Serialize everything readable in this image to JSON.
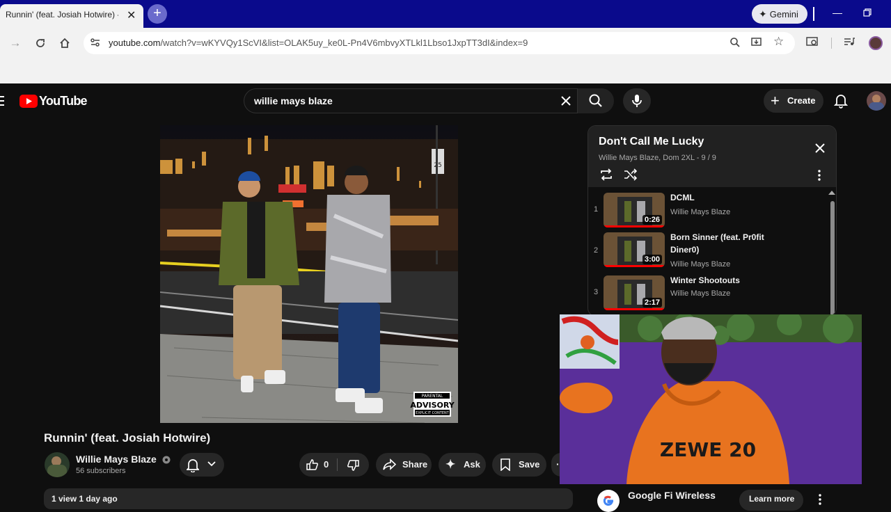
{
  "browser": {
    "tab_title": "Runnin' (feat. Josiah Hotwire) -",
    "tab_close": "✕",
    "new_tab": "+",
    "gemini_label": "Gemini",
    "url_host": "youtube.com",
    "url_path": "/watch?v=wKYVQy1ScVI&list=OLAK5uy_ke0L-Pn4V6mbvyXTLkl1Lbso1JxpTT3dI&index=9"
  },
  "youtube": {
    "logo_text": "YouTube",
    "search_query": "willie mays blaze",
    "create_label": "Create"
  },
  "video": {
    "title": "Runnin' (feat. Josiah Hotwire)",
    "channel_name": "Willie Mays Blaze",
    "subscribers": "56 subscribers",
    "like_count": "0",
    "share_label": "Share",
    "ask_label": "Ask",
    "save_label": "Save",
    "meta": "1 view  1 day ago",
    "advisory_top": "PARENTAL",
    "advisory_mid": "ADVISORY",
    "advisory_bottom": "EXPLICIT CONTENT",
    "street_sign": "25"
  },
  "playlist": {
    "title": "Don't Call Me Lucky",
    "meta": "Willie Mays Blaze, Dom 2XL - 9 / 9",
    "items": [
      {
        "index": "1",
        "name": "DCML",
        "artist": "Willie Mays Blaze",
        "duration": "0:26"
      },
      {
        "index": "2",
        "name": "Born Sinner (feat. Pr0fit Diner0)",
        "artist": "Willie Mays Blaze",
        "duration": "3:00"
      },
      {
        "index": "3",
        "name": "Winter Shootouts",
        "artist": "Willie Mays Blaze",
        "duration": "2:17"
      }
    ]
  },
  "ad": {
    "advertiser": "Google Fi Wireless",
    "cta": "Learn more"
  },
  "webcam": {
    "shirt_text": "ZEWE 20"
  },
  "colors": {
    "tabstrip": "#0a0a8c",
    "youtube_red": "#ff0000",
    "page_bg": "#0f0f0f",
    "hoodie": "#e8731f",
    "wall": "#5a2f9a"
  }
}
